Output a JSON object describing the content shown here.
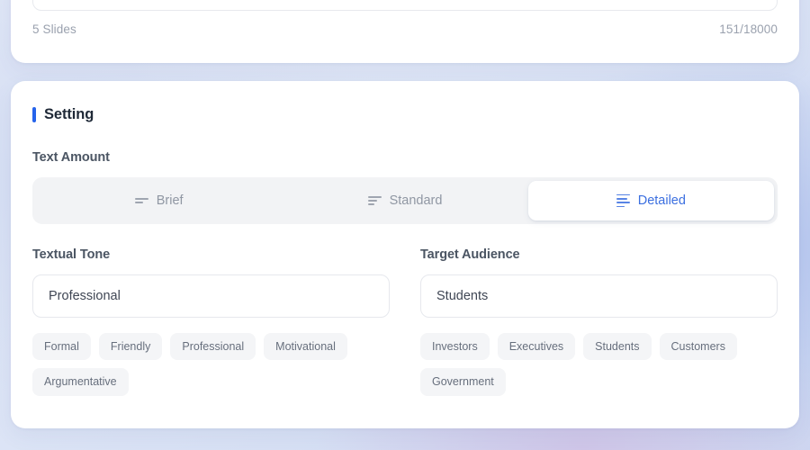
{
  "theme": {
    "accent_blue": "#2563eb",
    "selected_text_blue": "#3b6fe0",
    "card_background": "#ffffff",
    "track_background": "#f2f3f5",
    "chip_background": "#f4f5f7",
    "page_background": "#dde5f6"
  },
  "top_card": {
    "prompt_value": "",
    "prompt_placeholder": "",
    "slide_count_label": "5 Slides",
    "character_counter": "151/18000"
  },
  "settings": {
    "heading": "Setting",
    "text_amount": {
      "label": "Text Amount",
      "selected": "Detailed",
      "options": [
        {
          "label": "Brief",
          "icon": "list-short-icon",
          "lines": 2,
          "selected": false
        },
        {
          "label": "Standard",
          "icon": "list-medium-icon",
          "lines": 3,
          "selected": false
        },
        {
          "label": "Detailed",
          "icon": "list-long-icon",
          "lines": 4,
          "selected": true
        }
      ]
    },
    "textual_tone": {
      "label": "Textual Tone",
      "value": "Professional",
      "placeholder": "Professional",
      "suggestions": [
        "Formal",
        "Friendly",
        "Professional",
        "Motivational",
        "Argumentative"
      ]
    },
    "target_audience": {
      "label": "Target Audience",
      "value": "Students",
      "placeholder": "Students",
      "suggestions": [
        "Investors",
        "Executives",
        "Students",
        "Customers",
        "Government"
      ]
    }
  }
}
